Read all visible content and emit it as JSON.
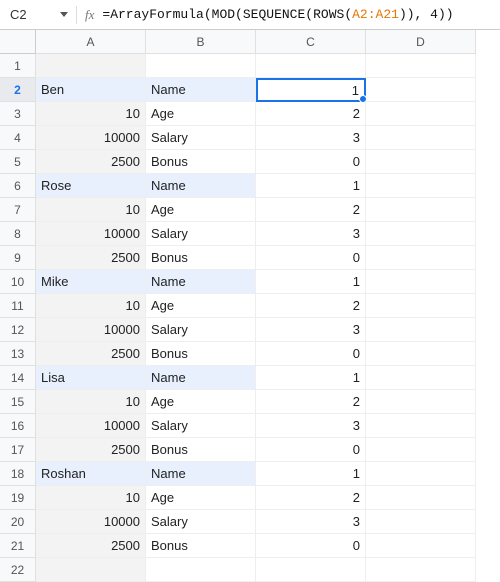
{
  "formula_bar": {
    "cell_ref": "C2",
    "fx_label": "fx",
    "formula_prefix": "=",
    "func_arrayformula": "ArrayFormula",
    "func_mod": "MOD",
    "func_sequence": "SEQUENCE",
    "func_rows": "ROWS",
    "ref": "A2:A21",
    "mod_divisor": "4"
  },
  "cols": [
    "A",
    "B",
    "C",
    "D"
  ],
  "rows": [
    {
      "n": "1",
      "a": "",
      "at": "txt",
      "b": "",
      "c": "",
      "sel": false,
      "hl": false
    },
    {
      "n": "2",
      "a": "Ben",
      "at": "txt",
      "b": "Name",
      "c": "1",
      "sel": true,
      "hl": true
    },
    {
      "n": "3",
      "a": "10",
      "at": "num",
      "b": "Age",
      "c": "2",
      "sel": false,
      "hl": false
    },
    {
      "n": "4",
      "a": "10000",
      "at": "num",
      "b": "Salary",
      "c": "3",
      "sel": false,
      "hl": false
    },
    {
      "n": "5",
      "a": "2500",
      "at": "num",
      "b": "Bonus",
      "c": "0",
      "sel": false,
      "hl": false
    },
    {
      "n": "6",
      "a": "Rose",
      "at": "txt",
      "b": "Name",
      "c": "1",
      "sel": false,
      "hl": true
    },
    {
      "n": "7",
      "a": "10",
      "at": "num",
      "b": "Age",
      "c": "2",
      "sel": false,
      "hl": false
    },
    {
      "n": "8",
      "a": "10000",
      "at": "num",
      "b": "Salary",
      "c": "3",
      "sel": false,
      "hl": false
    },
    {
      "n": "9",
      "a": "2500",
      "at": "num",
      "b": "Bonus",
      "c": "0",
      "sel": false,
      "hl": false
    },
    {
      "n": "10",
      "a": "Mike",
      "at": "txt",
      "b": "Name",
      "c": "1",
      "sel": false,
      "hl": true
    },
    {
      "n": "11",
      "a": "10",
      "at": "num",
      "b": "Age",
      "c": "2",
      "sel": false,
      "hl": false
    },
    {
      "n": "12",
      "a": "10000",
      "at": "num",
      "b": "Salary",
      "c": "3",
      "sel": false,
      "hl": false
    },
    {
      "n": "13",
      "a": "2500",
      "at": "num",
      "b": "Bonus",
      "c": "0",
      "sel": false,
      "hl": false
    },
    {
      "n": "14",
      "a": "Lisa",
      "at": "txt",
      "b": "Name",
      "c": "1",
      "sel": false,
      "hl": true
    },
    {
      "n": "15",
      "a": "10",
      "at": "num",
      "b": "Age",
      "c": "2",
      "sel": false,
      "hl": false
    },
    {
      "n": "16",
      "a": "10000",
      "at": "num",
      "b": "Salary",
      "c": "3",
      "sel": false,
      "hl": false
    },
    {
      "n": "17",
      "a": "2500",
      "at": "num",
      "b": "Bonus",
      "c": "0",
      "sel": false,
      "hl": false
    },
    {
      "n": "18",
      "a": "Roshan",
      "at": "txt",
      "b": "Name",
      "c": "1",
      "sel": false,
      "hl": true
    },
    {
      "n": "19",
      "a": "10",
      "at": "num",
      "b": "Age",
      "c": "2",
      "sel": false,
      "hl": false
    },
    {
      "n": "20",
      "a": "10000",
      "at": "num",
      "b": "Salary",
      "c": "3",
      "sel": false,
      "hl": false
    },
    {
      "n": "21",
      "a": "2500",
      "at": "num",
      "b": "Bonus",
      "c": "0",
      "sel": false,
      "hl": false
    },
    {
      "n": "22",
      "a": "",
      "at": "txt",
      "b": "",
      "c": "",
      "sel": false,
      "hl": false
    }
  ]
}
